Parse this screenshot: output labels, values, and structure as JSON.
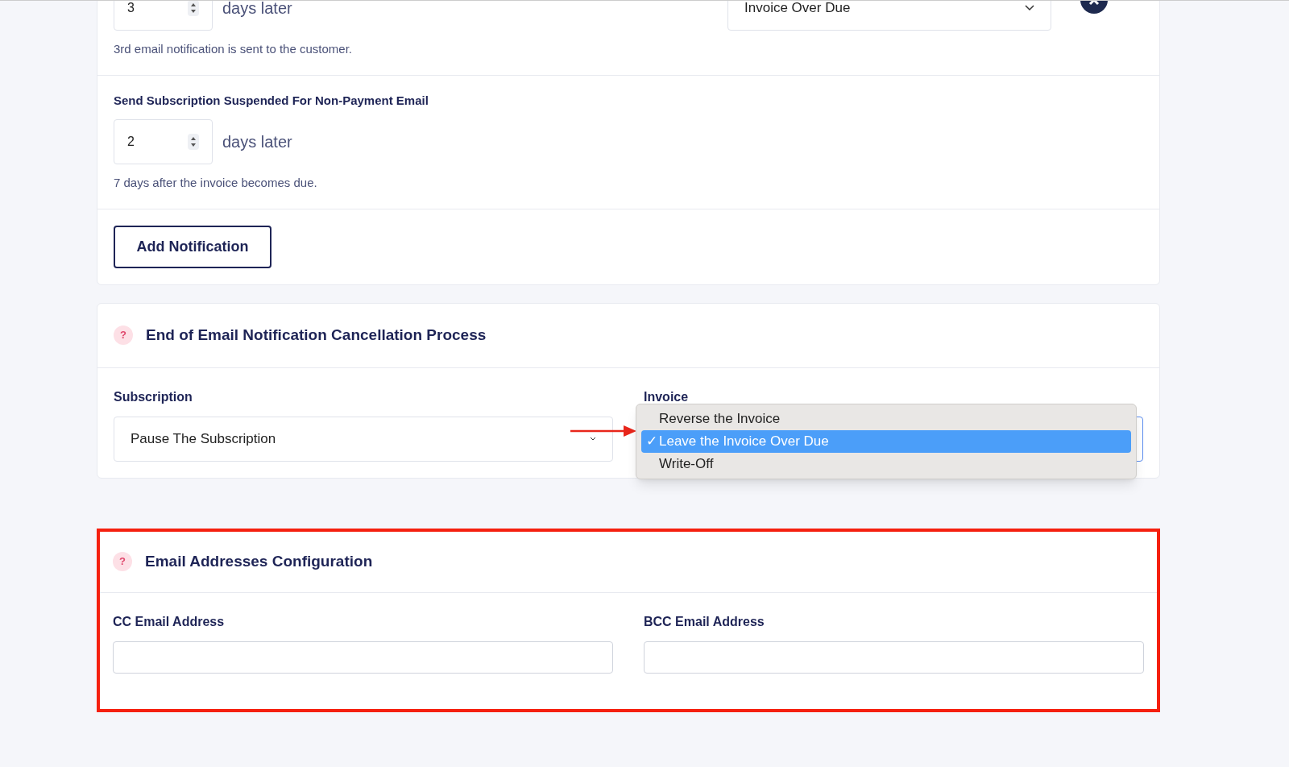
{
  "notifications": [
    {
      "days": "3",
      "unit": "days later",
      "status_select": "Invoice Over Due",
      "helper": "3rd email notification is sent to the customer.",
      "removable": true
    },
    {
      "label": "Send Subscription Suspended For Non-Payment Email",
      "days": "2",
      "unit": "days later",
      "helper": "7 days after the invoice becomes due.",
      "removable": false
    }
  ],
  "add_button": "Add Notification",
  "cancellation": {
    "help_icon": "?",
    "title": "End of Email Notification Cancellation Process",
    "subscription": {
      "label": "Subscription",
      "value": "Pause The Subscription"
    },
    "invoice": {
      "label": "Invoice",
      "options": [
        {
          "label": "Reverse the Invoice",
          "selected": false
        },
        {
          "label": "Leave the Invoice Over Due",
          "selected": true
        },
        {
          "label": "Write-Off",
          "selected": false
        }
      ],
      "check_mark": "✓"
    }
  },
  "email_config": {
    "help_icon": "?",
    "title": "Email Addresses Configuration",
    "highlighted": true,
    "fields": [
      {
        "label": "CC Email Address"
      },
      {
        "label": "BCC Email Address"
      }
    ]
  }
}
